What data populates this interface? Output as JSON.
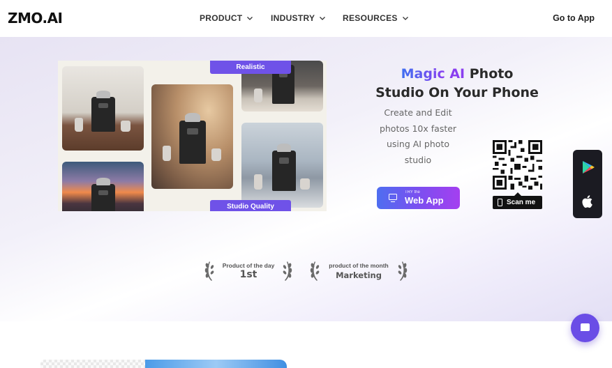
{
  "header": {
    "logo": "ZMO.AI",
    "nav": [
      {
        "label": "PRODUCT"
      },
      {
        "label": "INDUSTRY"
      },
      {
        "label": "RESOURCES"
      }
    ],
    "go_to_app": "Go to App"
  },
  "hero": {
    "title_magic": "Magic",
    "title_ai": "AI",
    "title_photo": "Photo",
    "title_line2": "Studio On Your Phone",
    "subtitle": "Create and Edit photos 10x faster using AI photo studio",
    "tags": {
      "realistic": "Realistic",
      "studio": "Studio Quality"
    },
    "try_button": {
      "small": "TRY the",
      "big": "Web App"
    },
    "scan_label": "Scan me"
  },
  "store": {
    "play_icon": "google-play-icon",
    "apple_icon": "apple-icon"
  },
  "awards": [
    {
      "top": "Product of the day",
      "main": "1st"
    },
    {
      "top": "product of the month",
      "main": "Marketing"
    }
  ],
  "colors": {
    "accent": "#6f52e8",
    "gradient_start": "#4e6ef0",
    "gradient_end": "#a43ff0",
    "store_panel": "#1b1b22"
  }
}
